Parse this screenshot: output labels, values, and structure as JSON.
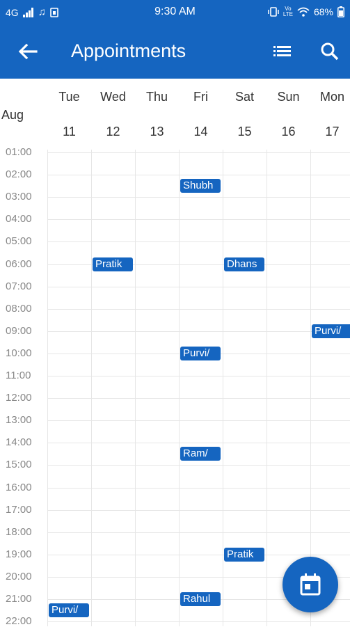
{
  "status_bar": {
    "network": "4G",
    "time": "9:30 AM",
    "battery": "68%",
    "icons": [
      "signal-icon",
      "music-note-icon",
      "sim-icon",
      "vibrate-icon",
      "volte-icon",
      "wifi-icon",
      "battery-icon"
    ]
  },
  "app_bar": {
    "title": "Appointments",
    "back_icon": "arrow-back-icon",
    "list_icon": "list-view-icon",
    "search_icon": "search-icon"
  },
  "calendar": {
    "month": "Aug",
    "days": [
      {
        "weekday": "Tue",
        "date": "11"
      },
      {
        "weekday": "Wed",
        "date": "12"
      },
      {
        "weekday": "Thu",
        "date": "13"
      },
      {
        "weekday": "Fri",
        "date": "14"
      },
      {
        "weekday": "Sat",
        "date": "15"
      },
      {
        "weekday": "Sun",
        "date": "16"
      },
      {
        "weekday": "Mon",
        "date": "17"
      }
    ],
    "hours": [
      "01:00",
      "02:00",
      "03:00",
      "04:00",
      "05:00",
      "06:00",
      "07:00",
      "08:00",
      "09:00",
      "10:00",
      "11:00",
      "12:00",
      "13:00",
      "14:00",
      "15:00",
      "16:00",
      "17:00",
      "18:00",
      "19:00",
      "20:00",
      "21:00",
      "22:00"
    ],
    "appointments": [
      {
        "label": "Shubh",
        "day": "14",
        "time": "02:30"
      },
      {
        "label": "Pratik",
        "day": "12",
        "time": "06:00"
      },
      {
        "label": "Dhans",
        "day": "15",
        "time": "06:00"
      },
      {
        "label": "Purvi/",
        "day": "17",
        "time": "09:00"
      },
      {
        "label": "Purvi/",
        "day": "14",
        "time": "10:00"
      },
      {
        "label": "Ram/",
        "day": "14",
        "time": "14:30"
      },
      {
        "label": "Pratik",
        "day": "15",
        "time": "19:00"
      },
      {
        "label": "Rahul",
        "day": "14",
        "time": "21:00"
      },
      {
        "label": "Purvi/",
        "day": "11",
        "time": "21:30"
      }
    ]
  },
  "fab": {
    "icon": "calendar-today-icon"
  }
}
